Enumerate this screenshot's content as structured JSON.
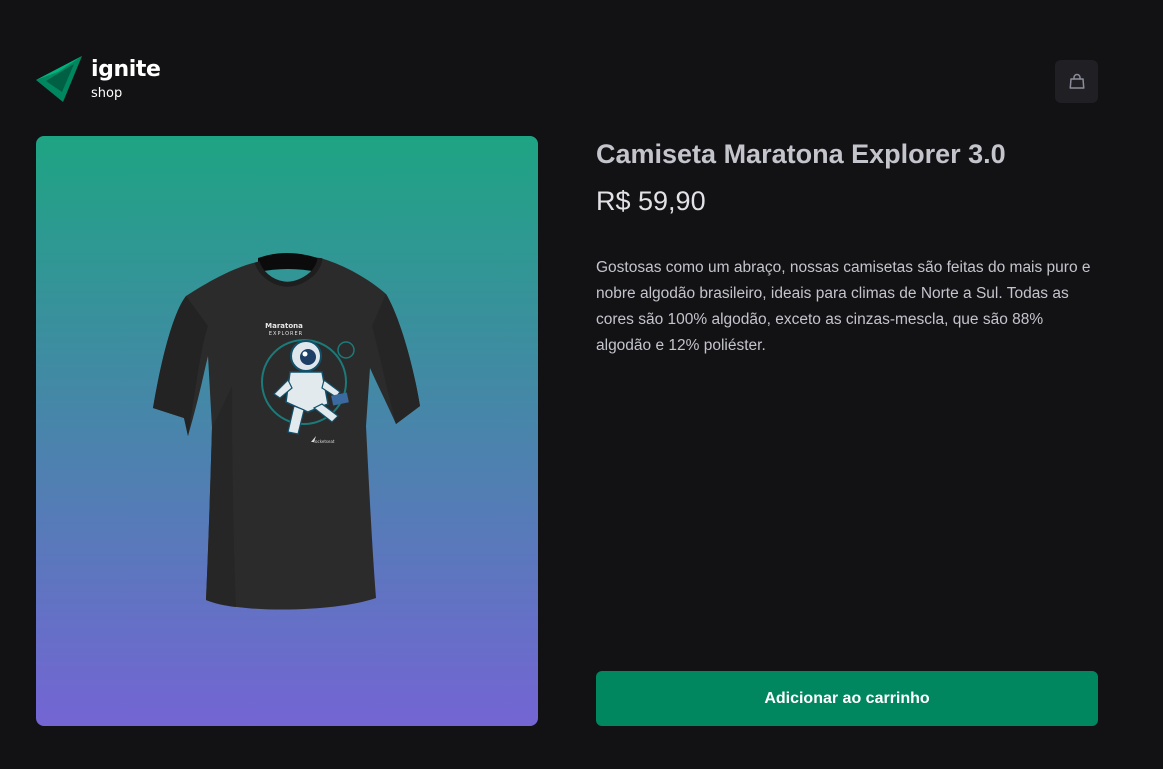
{
  "header": {
    "logo_title": "ignite",
    "logo_subtitle": "shop",
    "cart_icon": "shopping-bag-icon"
  },
  "product": {
    "image_alt": "Camiseta Maratona Explorer 3.0",
    "title": "Camiseta Maratona Explorer 3.0",
    "price": "R$ 59,90",
    "description": "Gostosas como um abraço, nossas camisetas são feitas do mais puro e nobre algodão brasileiro, ideais para climas de Norte a Sul. Todas as cores são 100% algodão, exceto as cinzas-mescla, que são 88% algodão e 12% poliéster.",
    "add_button_label": "Adicionar ao carrinho",
    "shirt_print_title": "Maratona",
    "shirt_print_subtitle": "EXPLORER",
    "shirt_print_brand": "rocketseat"
  },
  "colors": {
    "background": "#121214",
    "brand_green": "#00875f",
    "gradient_start": "#1ea483",
    "gradient_end": "#7465d4",
    "title_text": "#c4c4cc",
    "cart_button_bg": "#202024"
  }
}
